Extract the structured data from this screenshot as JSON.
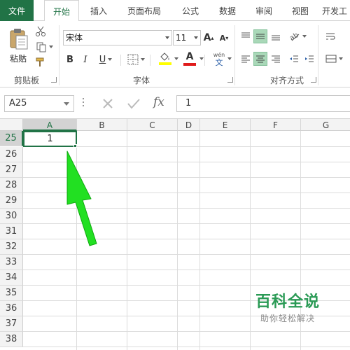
{
  "tabs": [
    {
      "label": "文件"
    },
    {
      "label": "开始"
    },
    {
      "label": "插入"
    },
    {
      "label": "页面布局"
    },
    {
      "label": "公式"
    },
    {
      "label": "数据"
    },
    {
      "label": "审阅"
    },
    {
      "label": "视图"
    },
    {
      "label": "开发工"
    }
  ],
  "ribbon": {
    "clipboard": {
      "paste_label": "粘贴",
      "group_label": "剪贴板"
    },
    "font": {
      "family": "宋体",
      "size": "11",
      "bold": "B",
      "italic": "I",
      "underline": "U",
      "font_color_letter": "A",
      "grow_letter": "A",
      "shrink_letter": "A",
      "phonetic_top": "wén",
      "phonetic_bottom": "文",
      "group_label": "字体",
      "fill_color": "#ffff00",
      "font_color": "#e01b1b"
    },
    "alignment": {
      "group_label": "对齐方式"
    }
  },
  "formula_bar": {
    "name_box": "A25",
    "fx": "fx",
    "value": "1"
  },
  "grid": {
    "columns": [
      "A",
      "B",
      "C",
      "D",
      "E",
      "F",
      "G"
    ],
    "rows": [
      "25",
      "26",
      "27",
      "28",
      "29",
      "30",
      "31",
      "32",
      "33",
      "34",
      "35",
      "36",
      "37",
      "38"
    ],
    "active_cell_value": "1"
  },
  "watermark": {
    "title": "百科全说",
    "subtitle": "助你轻松解决"
  },
  "colors": {
    "accent": "#217346",
    "arrow_green": "#22e022"
  }
}
